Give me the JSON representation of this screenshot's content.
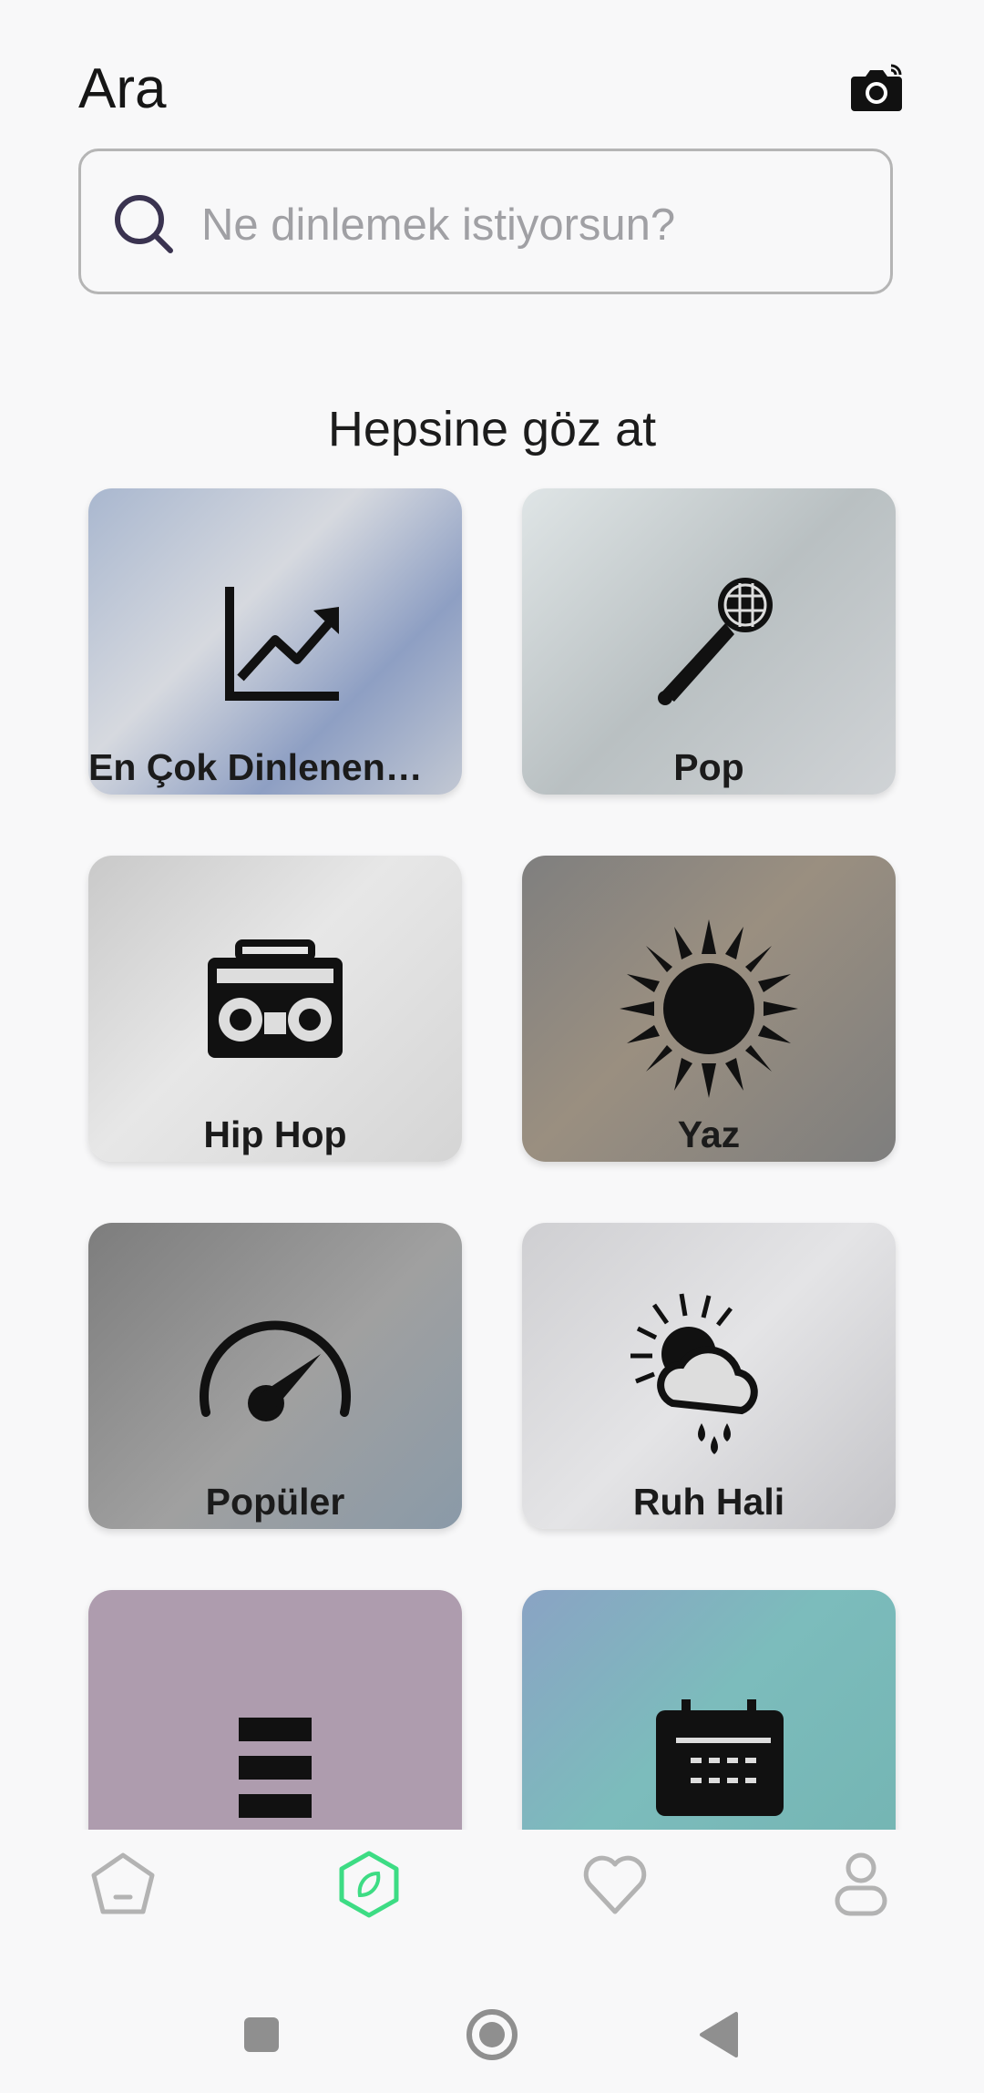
{
  "header": {
    "title": "Ara",
    "camera_icon": "camera-icon"
  },
  "search": {
    "placeholder": "Ne dinlemek istiyorsun?",
    "value": "",
    "icon": "search-icon"
  },
  "browse": {
    "title": "Hepsine göz at",
    "categories": [
      {
        "label": "En Çok Dinlenen …",
        "icon": "trending-chart-icon",
        "color": "#9aa9c4"
      },
      {
        "label": "Pop",
        "icon": "microphone-icon",
        "color": "#c5cccc"
      },
      {
        "label": "Hip Hop",
        "icon": "boombox-icon",
        "color": "#d8d8d8"
      },
      {
        "label": "Yaz",
        "icon": "sun-icon",
        "color": "#8a8680"
      },
      {
        "label": "Popüler",
        "icon": "speedometer-icon",
        "color": "#8c8c8c"
      },
      {
        "label": "Ruh Hali",
        "icon": "weather-mood-icon",
        "color": "#cfcfd2"
      },
      {
        "label": "",
        "icon": "menu-bars-icon",
        "color": "#ae9cae"
      },
      {
        "label": "",
        "icon": "calendar-icon",
        "color": "#7cbcbc"
      }
    ]
  },
  "bottom_nav": {
    "items": [
      {
        "name": "home",
        "icon": "home-icon"
      },
      {
        "name": "discover",
        "icon": "compass-icon",
        "active": true
      },
      {
        "name": "favorites",
        "icon": "heart-icon"
      },
      {
        "name": "profile",
        "icon": "profile-icon"
      }
    ],
    "active_color": "#3ddc84",
    "inactive_color": "#b3b3b3"
  },
  "system_nav": {
    "items": [
      "recents-icon",
      "home-circle-icon",
      "back-icon"
    ]
  }
}
